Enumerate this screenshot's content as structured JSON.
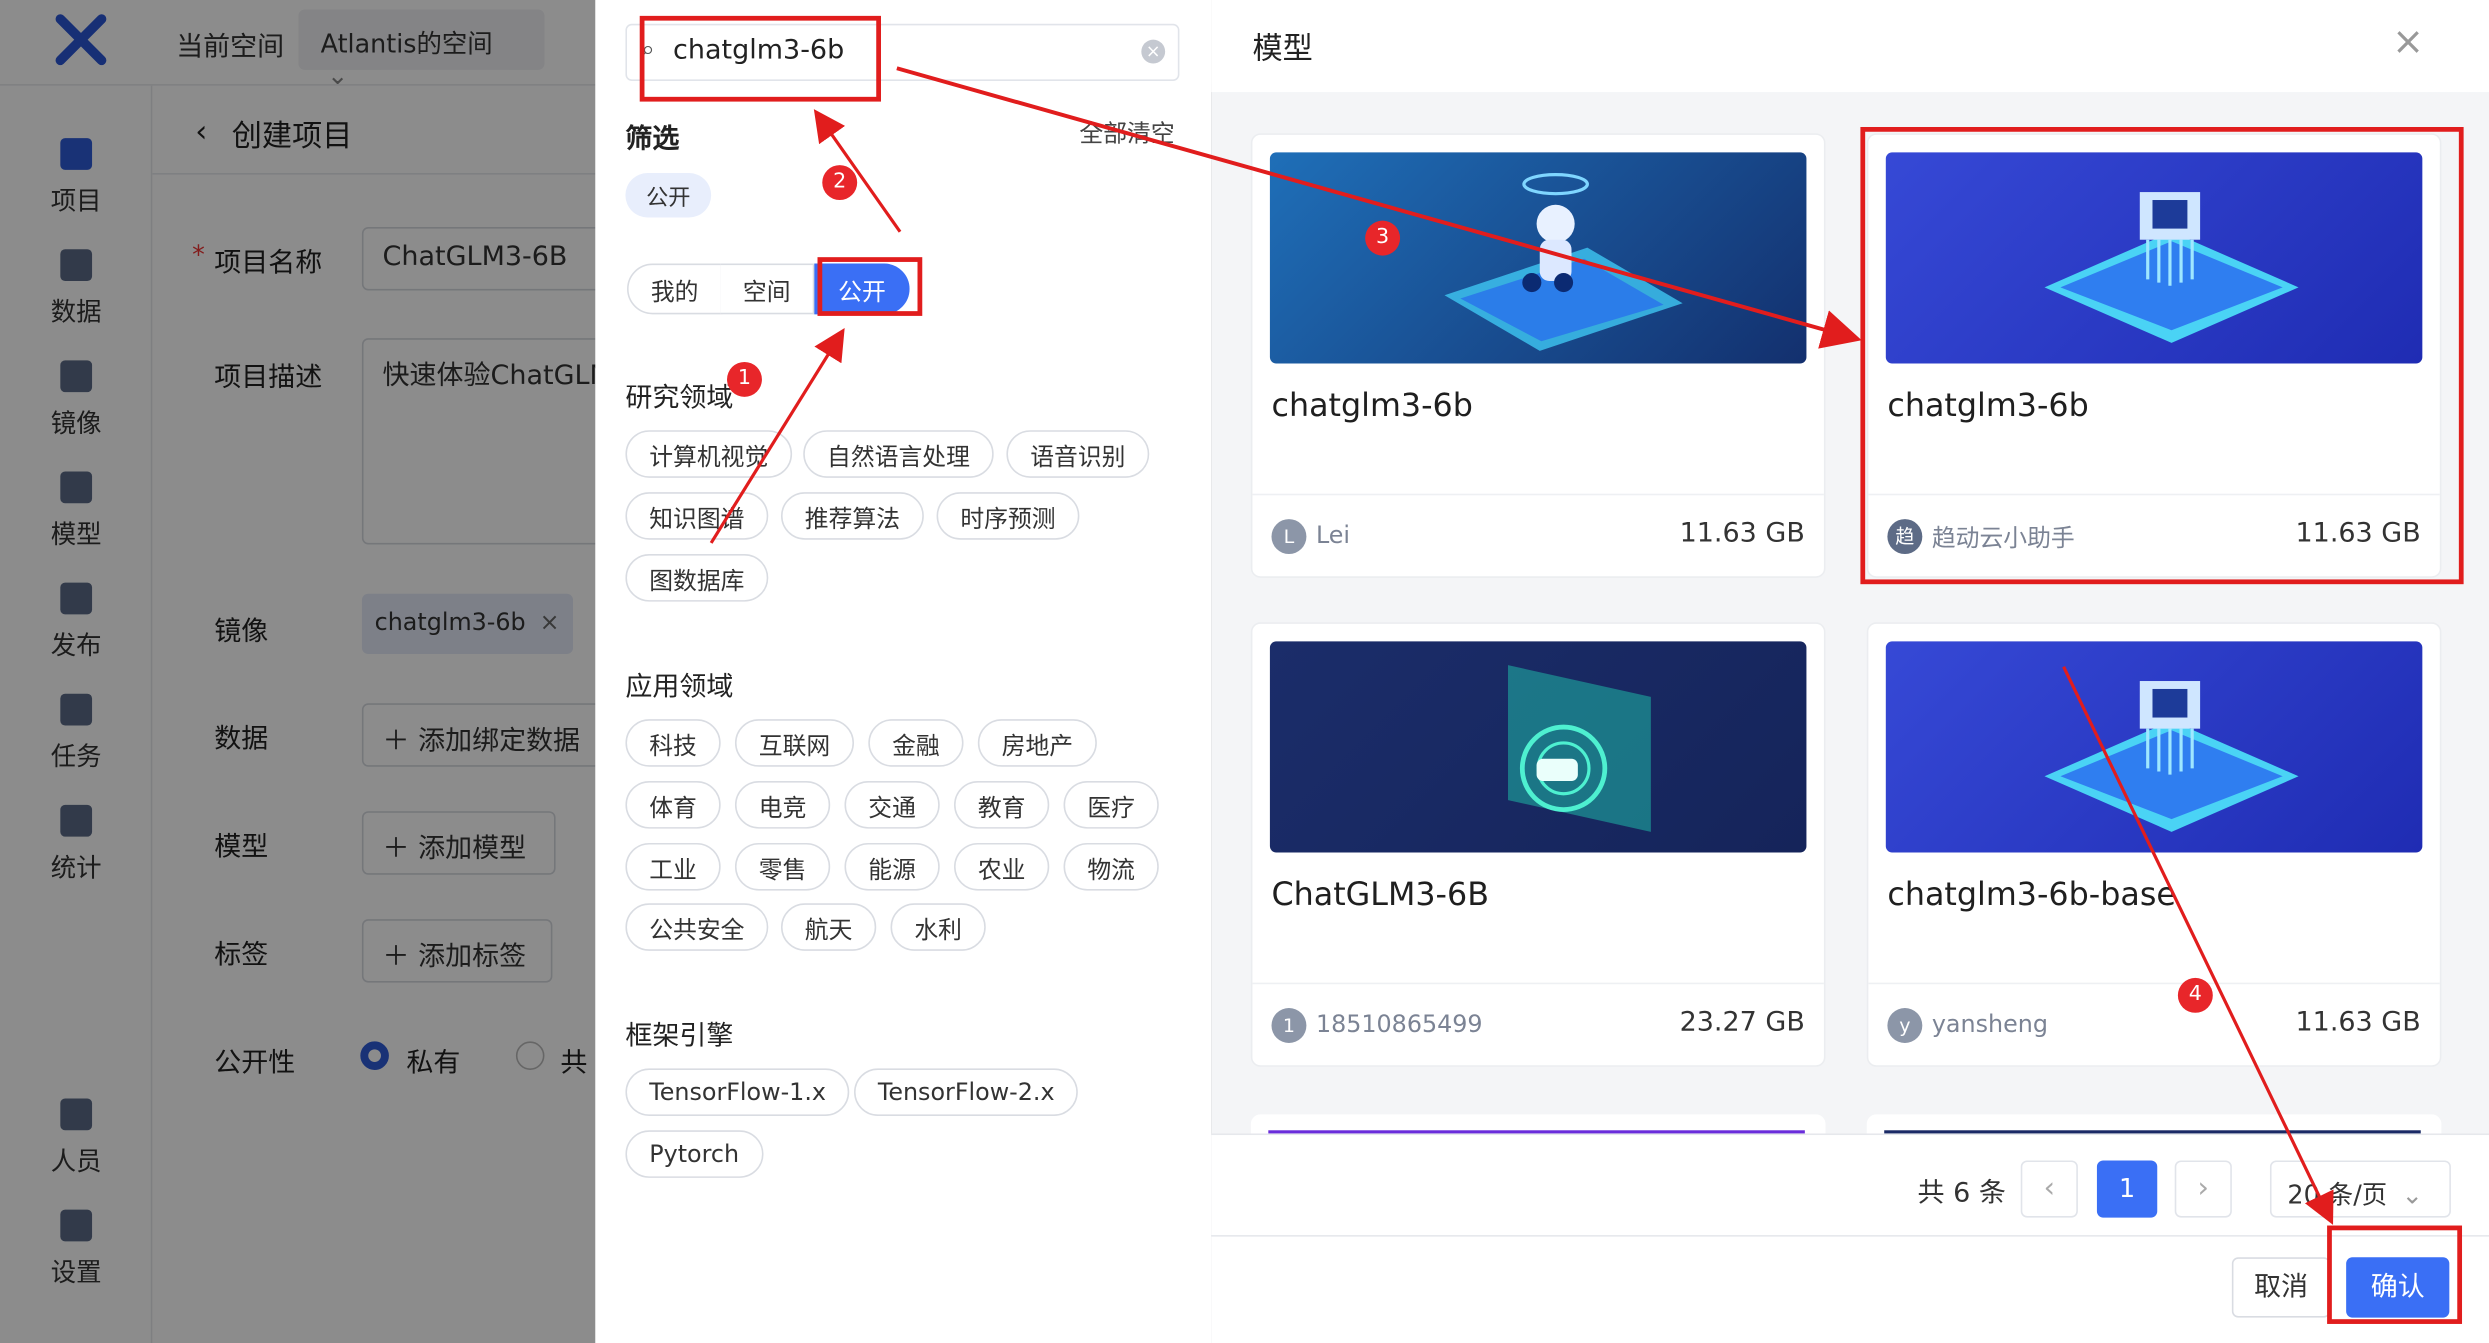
{
  "app": {
    "current_space_label": "当前空间",
    "space_name": "Atlantis的空间",
    "sidebar": [
      {
        "label": "项目",
        "icon": "folder-icon"
      },
      {
        "label": "数据",
        "icon": "database-icon"
      },
      {
        "label": "镜像",
        "icon": "image-icon"
      },
      {
        "label": "模型",
        "icon": "cube-icon"
      },
      {
        "label": "发布",
        "icon": "send-icon"
      },
      {
        "label": "任务",
        "icon": "task-icon"
      },
      {
        "label": "统计",
        "icon": "chart-icon"
      },
      {
        "label": "人员",
        "icon": "people-icon"
      },
      {
        "label": "设置",
        "icon": "gear-icon"
      }
    ],
    "page_title": "创建项目",
    "form": {
      "name_label": "项目名称",
      "name_value": "ChatGLM3-6B",
      "desc_label": "项目描述",
      "desc_value": "快速体验ChatGLM",
      "image_label": "镜像",
      "image_tag": "chatglm3-6b",
      "data_label": "数据",
      "data_button": "添加绑定数据",
      "model_label": "模型",
      "model_button": "添加模型",
      "tag_label": "标签",
      "tag_button": "添加标签",
      "visibility_label": "公开性",
      "private_label": "私有",
      "public_label": "共"
    }
  },
  "filter": {
    "search_value": "chatglm3-6b",
    "filter_title": "筛选",
    "clear_all": "全部清空",
    "active_chip": "公开",
    "segments": [
      "我的",
      "空间",
      "公开"
    ],
    "research_title": "研究领域",
    "research_tags": [
      "计算机视觉",
      "自然语言处理",
      "语音识别",
      "知识图谱",
      "推荐算法",
      "时序预测",
      "图数据库"
    ],
    "application_title": "应用领域",
    "application_tags": [
      "科技",
      "互联网",
      "金融",
      "房地产",
      "体育",
      "电竞",
      "交通",
      "教育",
      "医疗",
      "工业",
      "零售",
      "能源",
      "农业",
      "物流",
      "公共安全",
      "航天",
      "水利"
    ],
    "framework_title": "框架引擎",
    "framework_tags": [
      "TensorFlow-1.x",
      "TensorFlow-2.x",
      "Pytorch"
    ]
  },
  "models_panel": {
    "title": "模型",
    "cards": [
      {
        "name": "chatglm3-6b",
        "avatar": "L",
        "owner": "Lei",
        "size": "11.63 GB"
      },
      {
        "name": "chatglm3-6b",
        "avatar": "趋",
        "owner": "趋动云小助手",
        "size": "11.63 GB"
      },
      {
        "name": "ChatGLM3-6B",
        "avatar": "1",
        "owner": "18510865499",
        "size": "23.27 GB"
      },
      {
        "name": "chatglm3-6b-base",
        "avatar": "y",
        "owner": "yansheng",
        "size": "11.63 GB"
      }
    ],
    "pagination": {
      "total": "共 6 条",
      "current_page": "1",
      "page_size": "20 条/页"
    },
    "cancel": "取消",
    "confirm": "确认"
  },
  "annotations": [
    "1",
    "2",
    "3",
    "4"
  ],
  "colors": {
    "primary": "#3a6ff5",
    "annotation_red": "#e11d1d"
  }
}
